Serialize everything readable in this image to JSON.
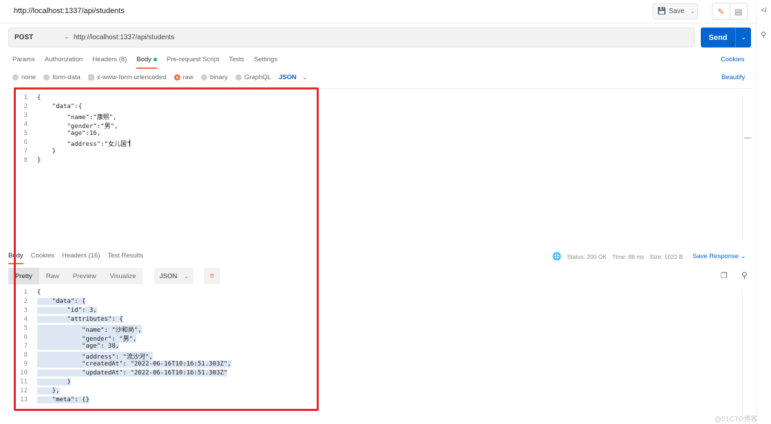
{
  "titlebar": {
    "title": "http://localhost:1337/api/students",
    "save_label": "Save"
  },
  "request": {
    "method": "POST",
    "url": "http://localhost:1337/api/students",
    "send_label": "Send",
    "tabs": [
      {
        "label": "Params"
      },
      {
        "label": "Authorization"
      },
      {
        "label": "Headers (8)"
      },
      {
        "label": "Body"
      },
      {
        "label": "Pre-request Script"
      },
      {
        "label": "Tests"
      },
      {
        "label": "Settings"
      }
    ],
    "cookies_label": "Cookies",
    "body_types": [
      {
        "label": "none"
      },
      {
        "label": "form-data"
      },
      {
        "label": "x-www-form-urlencoded"
      },
      {
        "label": "raw"
      },
      {
        "label": "binary"
      },
      {
        "label": "GraphQL"
      }
    ],
    "body_format": "JSON",
    "beautify_label": "Beautify",
    "body_lines": [
      {
        "n": "1",
        "t": "{"
      },
      {
        "n": "2",
        "t": "    \"data\":{"
      },
      {
        "n": "3",
        "t": "        \"name\":\"康熙\","
      },
      {
        "n": "4",
        "t": "        \"gender\":\"男\","
      },
      {
        "n": "5",
        "t": "        \"age\":16,"
      },
      {
        "n": "6",
        "t": "        \"address\":\"女儿国\""
      },
      {
        "n": "7",
        "t": "    }"
      },
      {
        "n": "8",
        "t": "}"
      }
    ]
  },
  "response": {
    "tabs": [
      {
        "label": "Body"
      },
      {
        "label": "Cookies"
      },
      {
        "label": "Headers (16)"
      },
      {
        "label": "Test Results"
      }
    ],
    "status": "Status: 200 OK",
    "time": "Time: 88 ms",
    "size": "Size: 1022 B",
    "save_label": "Save Response",
    "view_tabs": [
      {
        "label": "Pretty"
      },
      {
        "label": "Raw"
      },
      {
        "label": "Preview"
      },
      {
        "label": "Visualize"
      }
    ],
    "format": "JSON",
    "body_lines": [
      {
        "n": "1",
        "t": "{"
      },
      {
        "n": "2",
        "t": "    \"data\": {"
      },
      {
        "n": "3",
        "t": "        \"id\": 3,"
      },
      {
        "n": "4",
        "t": "        \"attributes\": {"
      },
      {
        "n": "5",
        "t": "            \"name\": \"沙和尚\","
      },
      {
        "n": "6",
        "t": "            \"gender\": \"男\","
      },
      {
        "n": "7",
        "t": "            \"age\": 38,"
      },
      {
        "n": "8",
        "t": "            \"address\": \"流沙河\","
      },
      {
        "n": "9",
        "t": "            \"createdAt\": \"2022-06-16T10:16:51.303Z\","
      },
      {
        "n": "10",
        "t": "            \"updatedAt\": \"2022-06-16T10:16:51.303Z\""
      },
      {
        "n": "11",
        "t": "        }"
      },
      {
        "n": "12",
        "t": "    },"
      },
      {
        "n": "13",
        "t": "    \"meta\": {}"
      }
    ]
  },
  "watermark": "@51CTO博客",
  "colors": {
    "accent": "#f26b3a",
    "primary": "#0265d2",
    "highlight_box": "#e3272b"
  }
}
